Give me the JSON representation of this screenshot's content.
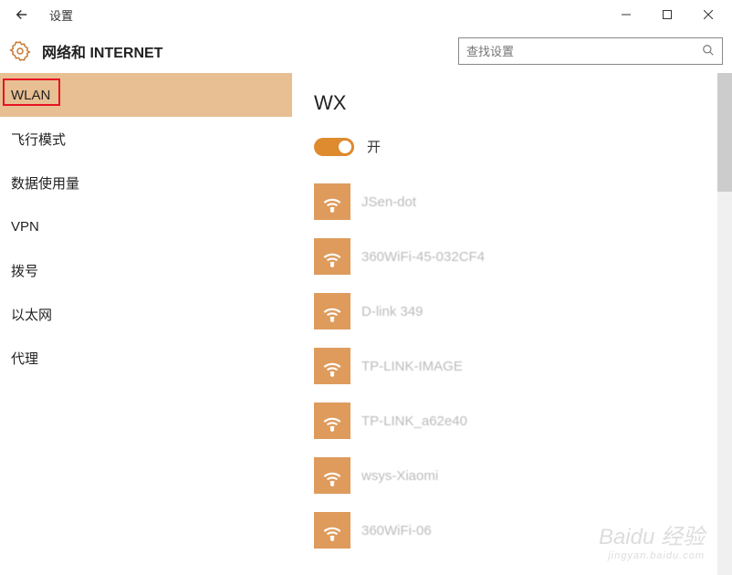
{
  "window": {
    "title": "设置"
  },
  "header": {
    "page_title": "网络和 INTERNET",
    "search_placeholder": "查找设置"
  },
  "sidebar": {
    "items": [
      {
        "label": "WLAN",
        "active": true
      },
      {
        "label": "飞行模式",
        "active": false
      },
      {
        "label": "数据使用量",
        "active": false
      },
      {
        "label": "VPN",
        "active": false
      },
      {
        "label": "拨号",
        "active": false
      },
      {
        "label": "以太网",
        "active": false
      },
      {
        "label": "代理",
        "active": false
      }
    ]
  },
  "content": {
    "section_title": "WX",
    "toggle": {
      "label": "开",
      "on": true
    },
    "wifi_list": [
      {
        "ssid": "JSen-dot"
      },
      {
        "ssid": "360WiFi-45-032CF4"
      },
      {
        "ssid": "D-link 349"
      },
      {
        "ssid": "TP-LINK-IMAGE"
      },
      {
        "ssid": "TP-LINK_a62e40"
      },
      {
        "ssid": "wsys-Xiaomi"
      },
      {
        "ssid": "360WiFi-06"
      }
    ]
  },
  "watermark": {
    "main": "Baidu 经验",
    "sub": "jingyan.baidu.com"
  }
}
